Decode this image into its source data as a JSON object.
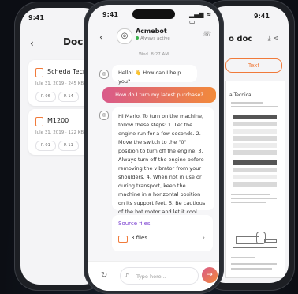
{
  "status_time": "9:41",
  "left_screen": {
    "title": "Docu",
    "documents": [
      {
        "name": "Scheda Tecnic",
        "date": "Jule 31, 2019",
        "size": "245 KB",
        "chips": [
          "P. 06",
          "P. 14"
        ]
      },
      {
        "name": "M1200",
        "date": "Jule 31, 2019",
        "size": "122 KB",
        "chips": [
          "P. 01",
          "P. 11"
        ]
      }
    ]
  },
  "chat": {
    "bot_name": "Acmebot",
    "bot_status": "Always active",
    "date_label": "Wed. 8:27 AM",
    "messages": [
      {
        "from": "bot",
        "text": "Hello! 👋 How can I help you?"
      },
      {
        "from": "user",
        "text": "How do I turn my latest purchase?"
      },
      {
        "from": "bot",
        "text": "Hi Mario. To turn on the machine, follow these steps: 1. Let the engine run for a few seconds. 2. Move the switch to the \"0\" position to turn off the engine. 3. Always turn off the engine before removing the vibrator from your shoulders. 4. When not in use or during transport, keep the machine in a horizontal position on its support feet. 5. Be cautious of the hot motor and let it cool down before touching any parts."
      }
    ],
    "sources_title": "Source files",
    "sources_count": "3 files",
    "input_placeholder": "Type here..."
  },
  "right_screen": {
    "title": "o doc",
    "toggle_label": "Text",
    "doc_heading": "a Tecnica"
  },
  "colors": {
    "accent_start": "#d95a8a",
    "accent_end": "#f28a3a",
    "orange": "#f07a3a",
    "source_purple": "#7a3fd0"
  }
}
